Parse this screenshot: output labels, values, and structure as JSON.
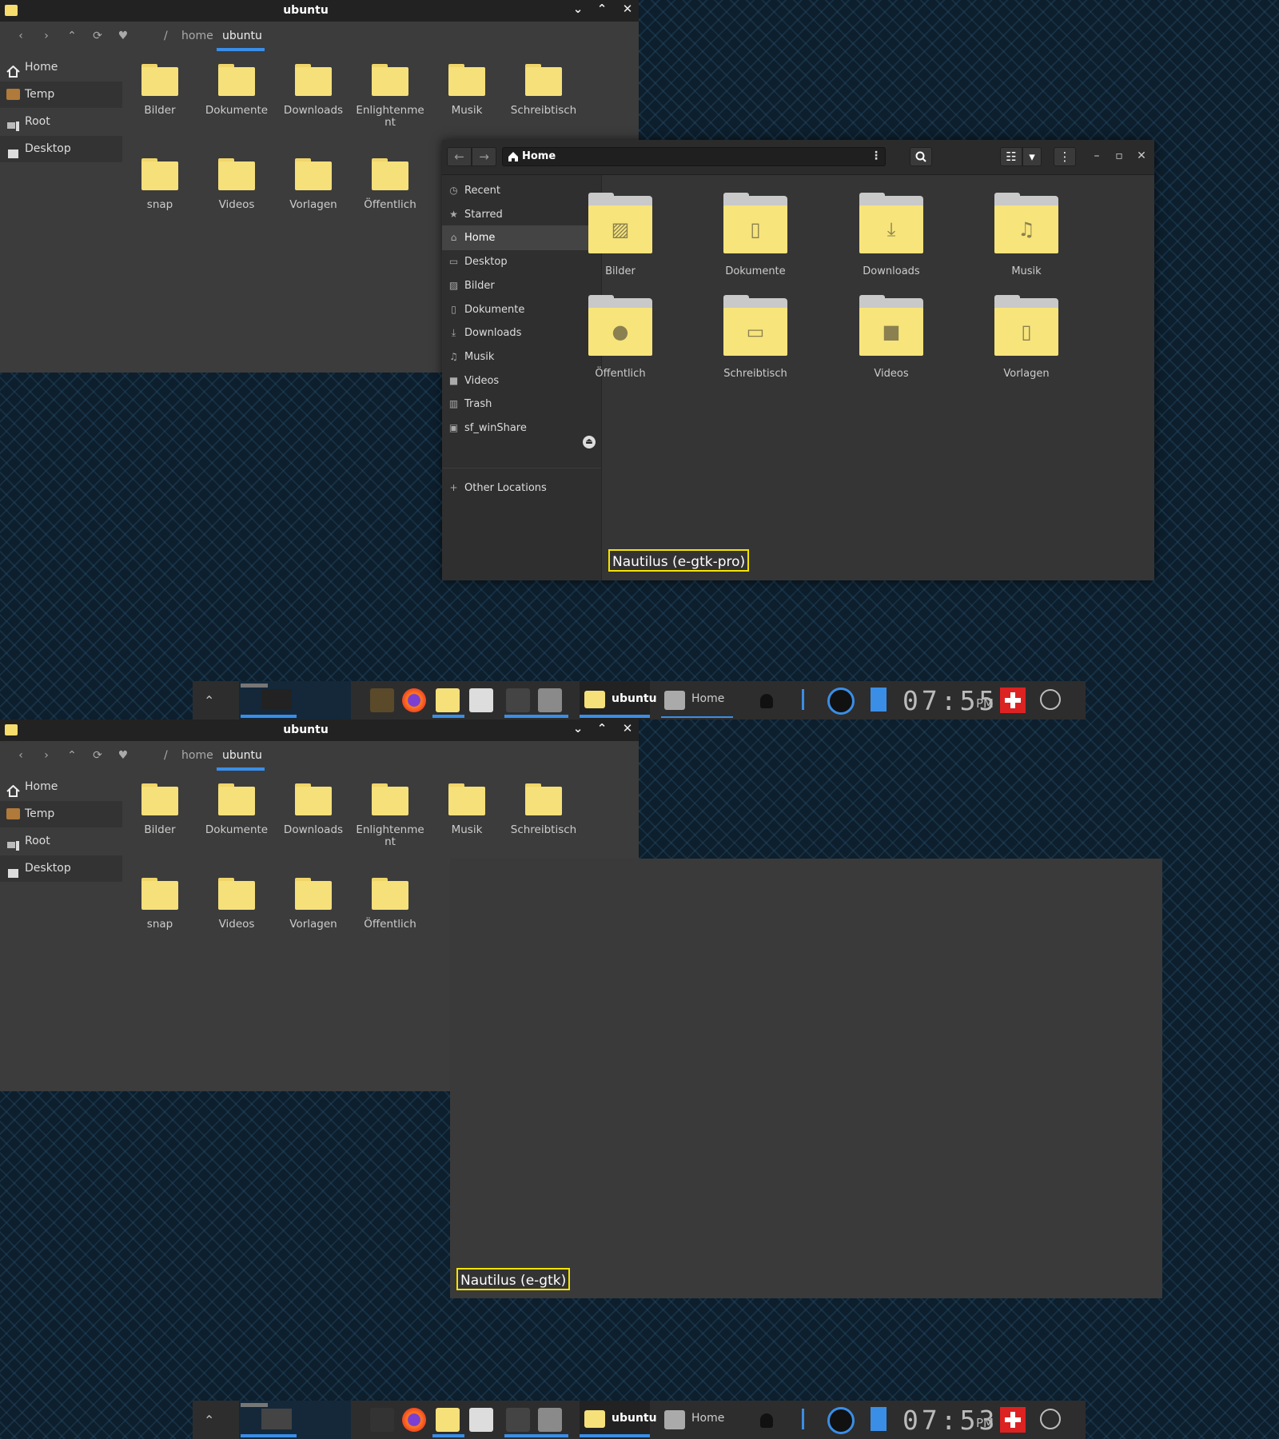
{
  "efm": {
    "title": "ubuntu",
    "window_buttons": {
      "minimize": "⌄",
      "maximize": "⌃",
      "close": "✕"
    },
    "nav": {
      "back": "‹",
      "forward": "›",
      "up": "⌃",
      "refresh": "⟳",
      "favorite": "♥"
    },
    "breadcrumb": {
      "root": "/",
      "home": "home",
      "current": "ubuntu"
    },
    "sidebar": [
      {
        "label": "Home",
        "icon": "home-icon"
      },
      {
        "label": "Temp",
        "icon": "temp-drive-icon"
      },
      {
        "label": "Root",
        "icon": "computer-icon"
      },
      {
        "label": "Desktop",
        "icon": "desktop-icon"
      }
    ],
    "files": [
      {
        "label": "Bilder"
      },
      {
        "label": "Dokumente"
      },
      {
        "label": "Downloads"
      },
      {
        "label": "Enlightenme\nnt"
      },
      {
        "label": "Musik"
      },
      {
        "label": "Schreibtisch"
      },
      {
        "label": "snap"
      },
      {
        "label": "Videos"
      },
      {
        "label": "Vorlagen"
      },
      {
        "label": "Öffentlich"
      }
    ],
    "folder_color": "#f5e07a"
  },
  "nautilus": {
    "location": "Home",
    "sidebar": [
      {
        "label": "Recent",
        "icon": "clock-icon"
      },
      {
        "label": "Starred",
        "icon": "star-icon"
      },
      {
        "label": "Home",
        "icon": "home-icon"
      },
      {
        "label": "Desktop",
        "icon": "desktop-icon"
      },
      {
        "label": "Bilder",
        "icon": "pictures-icon"
      },
      {
        "label": "Dokumente",
        "icon": "document-icon"
      },
      {
        "label": "Downloads",
        "icon": "download-icon"
      },
      {
        "label": "Musik",
        "icon": "music-icon"
      },
      {
        "label": "Videos",
        "icon": "video-icon"
      },
      {
        "label": "Trash",
        "icon": "trash-icon"
      },
      {
        "label": "sf_winShare",
        "icon": "drive-icon"
      },
      {
        "label": "Other Locations",
        "icon": "plus-icon"
      }
    ],
    "files": [
      {
        "label": "Bilder",
        "icon": "picture-icon"
      },
      {
        "label": "Dokumente",
        "icon": "document-icon"
      },
      {
        "label": "Downloads",
        "icon": "download-icon"
      },
      {
        "label": "Musik",
        "icon": "music-icon"
      },
      {
        "label": "Öffentlich",
        "icon": "user-icon"
      },
      {
        "label": "Schreibtisch",
        "icon": "desktop-icon"
      },
      {
        "label": "Videos",
        "icon": "video-icon"
      },
      {
        "label": "Vorlagen",
        "icon": "template-icon"
      }
    ],
    "caption_top": "Nautilus (e-gtk-pro)",
    "caption_bottom": "Nautilus (e-gtk)"
  },
  "taskbar_top": {
    "win1": "ubuntu",
    "win2": "Home",
    "clock": "07:55",
    "ampm": "PM"
  },
  "taskbar_bottom": {
    "win1": "ubuntu",
    "win2": "Home",
    "clock": "07:53",
    "ampm": "PM"
  },
  "colors": {
    "accent": "#3a8ee6",
    "caption_border": "#f5e400",
    "folder": "#f7e47b"
  }
}
